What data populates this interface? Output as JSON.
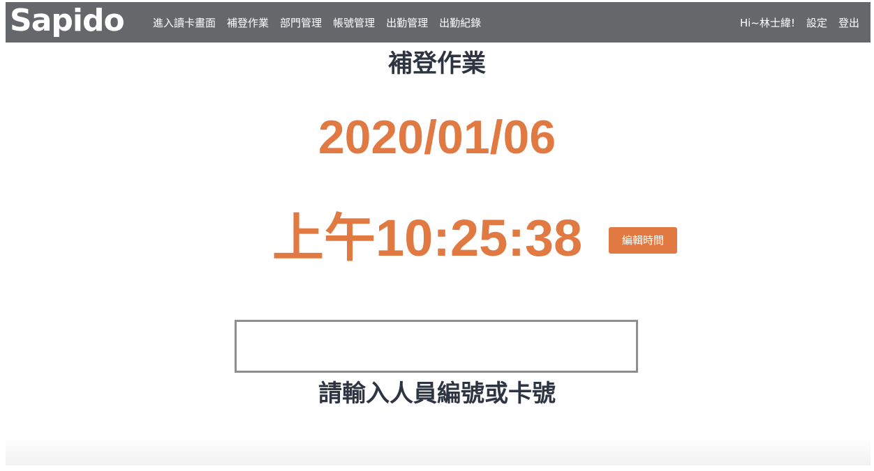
{
  "navbar": {
    "logo": "Sapido",
    "links": [
      {
        "label": "進入讀卡畫面"
      },
      {
        "label": "補登作業"
      },
      {
        "label": "部門管理"
      },
      {
        "label": "帳號管理"
      },
      {
        "label": "出勤管理"
      },
      {
        "label": "出勤紀錄"
      }
    ],
    "greeting": "Hi~林士緯!",
    "settings_label": "設定",
    "logout_label": "登出"
  },
  "main": {
    "title": "補登作業",
    "date": "2020/01/06",
    "time": "上午10:25:38",
    "edit_time_label": "編輯時間",
    "input_value": "",
    "hint": "請輸入人員編號或卡號"
  },
  "colors": {
    "navbar_bg": "#66676b",
    "accent": "#e07a42",
    "heading": "#2e3441"
  }
}
